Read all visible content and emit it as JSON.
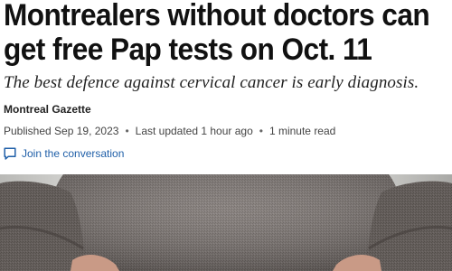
{
  "article": {
    "headline_line1": "Montrealers without doctors can",
    "headline_line2": "get free Pap tests on Oct. 11",
    "subhead": "The best defence against cervical cancer is early diagnosis.",
    "source": "Montreal Gazette",
    "published": "Published Sep 19, 2023",
    "updated": "Last updated 1 hour ago",
    "read_time": "1 minute read",
    "join_label": "Join the conversation"
  },
  "icons": {
    "comment": "comment-bubble-icon"
  },
  "colors": {
    "link": "#1f5fa8",
    "headline": "#111111"
  }
}
